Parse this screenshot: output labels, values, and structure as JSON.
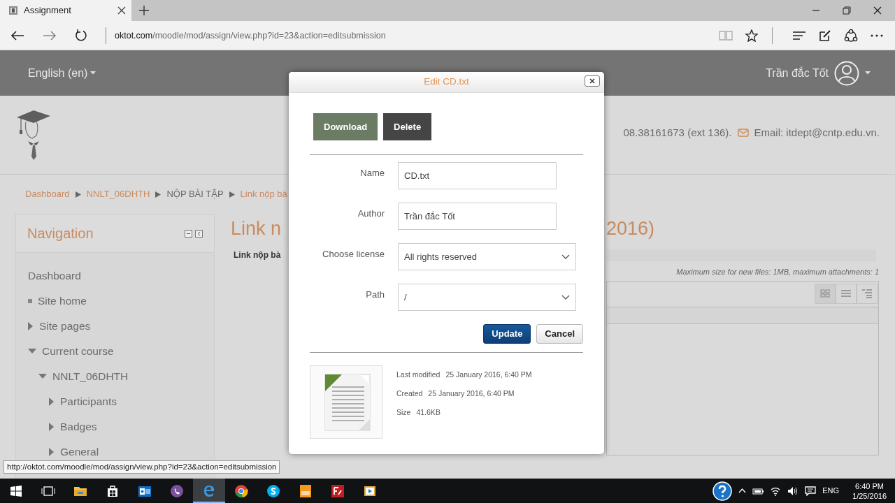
{
  "browser": {
    "tab": {
      "title": "Assignment",
      "selected": true
    },
    "address": {
      "domain": "oktot.com",
      "path": "/moodle/mod/assign/view.php?id=23&action=editsubmission"
    }
  },
  "header": {
    "language": "English (en)",
    "user": "Trần đắc Tốt"
  },
  "contact": {
    "phone": "08.38161673 (ext 136).",
    "email": "Email: itdept@cntp.edu.vn."
  },
  "breadcrumb": [
    {
      "label": "Dashboard",
      "kind": "link"
    },
    {
      "label": "NNLT_06DHTH",
      "kind": "link"
    },
    {
      "label": "NỘP BÀI TẬP",
      "kind": "text"
    },
    {
      "label": "Link nộp bà",
      "kind": "link"
    }
  ],
  "navigation": {
    "title": "Navigation",
    "items": [
      {
        "label": "Dashboard",
        "kind": "heading"
      },
      {
        "label": "Site home",
        "kind": "leaf"
      },
      {
        "label": "Site pages",
        "kind": "branch",
        "expanded": false
      },
      {
        "label": "Current course",
        "kind": "branch",
        "expanded": true,
        "children": [
          {
            "label": "NNLT_06DHTH",
            "kind": "branch",
            "expanded": true,
            "children": [
              {
                "label": "Participants",
                "kind": "branch",
                "expanded": false
              },
              {
                "label": "Badges",
                "kind": "branch",
                "expanded": false
              },
              {
                "label": "General",
                "kind": "branch",
                "expanded": false
              }
            ]
          }
        ]
      }
    ]
  },
  "main": {
    "title_start": "Link n",
    "title_end": "2016)",
    "intro": "Link nộp bà",
    "limits": "Maximum size for new files: 1MB, maximum attachments: 1"
  },
  "dialog": {
    "title": "Edit CD.txt",
    "buttons": [
      "Download",
      "Delete"
    ],
    "fields": [
      {
        "label": "Name",
        "kind": "text",
        "value": "CD.txt"
      },
      {
        "label": "Author",
        "kind": "text",
        "value": "Trần đắc Tốt"
      },
      {
        "label": "Choose license",
        "kind": "select",
        "value": "All rights reserved"
      },
      {
        "label": "Path",
        "kind": "select",
        "value": "/"
      }
    ],
    "actions": [
      "Update",
      "Cancel"
    ],
    "info": [
      {
        "label": "Last modified",
        "value": "25 January 2016, 6:40 PM"
      },
      {
        "label": "Created",
        "value": "25 January 2016, 6:40 PM"
      },
      {
        "label": "Size",
        "value": "41.6KB"
      }
    ]
  },
  "status_link": "http://oktot.com/moodle/mod/assign/view.php?id=23&action=editsubmission",
  "taskbar": {
    "apps": [
      {
        "selected": false
      },
      {
        "selected": false
      },
      {
        "selected": false
      },
      {
        "selected": false
      },
      {
        "selected": false
      },
      {
        "selected": true
      },
      {
        "selected": false
      },
      {
        "selected": false
      },
      {
        "selected": false
      },
      {
        "selected": false
      },
      {
        "selected": false
      }
    ],
    "language": "ENG",
    "time": "6:40 PM",
    "date": "1/25/2016"
  }
}
